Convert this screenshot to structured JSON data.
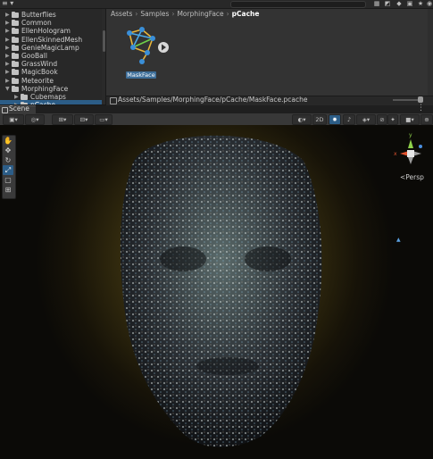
{
  "topbar": {
    "menu_icon": "hamburger-icon",
    "right_icons": [
      "grid-icon",
      "scene-icon",
      "tag-icon",
      "lock-icon",
      "star-icon",
      "eye-icon"
    ]
  },
  "project_tree": {
    "items": [
      {
        "label": "Butterflies",
        "expanded": false,
        "depth": 1
      },
      {
        "label": "Common",
        "expanded": false,
        "depth": 1
      },
      {
        "label": "EllenHologram",
        "expanded": false,
        "depth": 1
      },
      {
        "label": "EllenSkinnedMesh",
        "expanded": false,
        "depth": 1
      },
      {
        "label": "GenieMagicLamp",
        "expanded": false,
        "depth": 1
      },
      {
        "label": "GooBall",
        "expanded": false,
        "depth": 1
      },
      {
        "label": "GrassWind",
        "expanded": false,
        "depth": 1
      },
      {
        "label": "MagicBook",
        "expanded": false,
        "depth": 1
      },
      {
        "label": "Meteorite",
        "expanded": false,
        "depth": 1
      },
      {
        "label": "MorphingFace",
        "expanded": true,
        "depth": 1
      },
      {
        "label": "Cubemaps",
        "expanded": false,
        "depth": 2
      },
      {
        "label": "pCache",
        "expanded": false,
        "depth": 2,
        "selected": true
      }
    ]
  },
  "asset_pane": {
    "breadcrumb": [
      "Assets",
      "Samples",
      "MorphingFace",
      "pCache"
    ],
    "asset_name": "MaskFace",
    "path": "Assets/Samples/MorphingFace/pCache/MaskFace.pcache"
  },
  "scene_view": {
    "tab_label": "Scene",
    "mode_2d": "2D",
    "persp_label": "Persp",
    "gizmo_axes": {
      "y": "y",
      "x": "x",
      "z": "z"
    },
    "colors": {
      "selection": "#2c5d87",
      "y_axis": "#8ed14a",
      "x_axis": "#e0532f",
      "z_axis": "#4a8fe0"
    }
  },
  "tools": [
    "hand-tool-icon",
    "move-tool-icon",
    "rotate-tool-icon",
    "scale-tool-icon",
    "rect-tool-icon",
    "transform-tool-icon"
  ]
}
